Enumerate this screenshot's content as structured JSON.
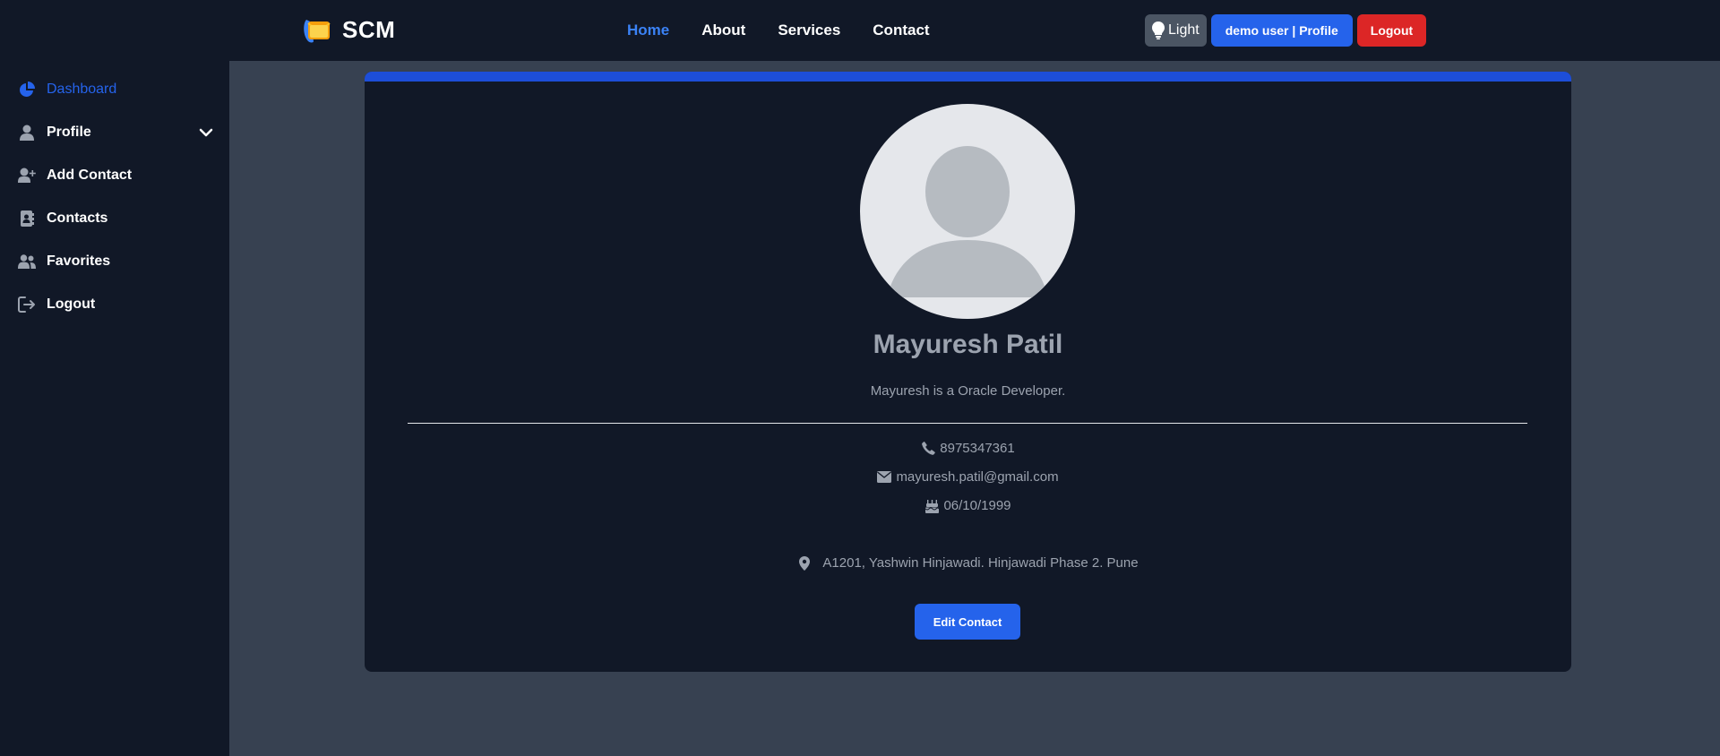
{
  "navbar": {
    "brand": "SCM",
    "links": [
      {
        "label": "Home",
        "active": true
      },
      {
        "label": "About",
        "active": false
      },
      {
        "label": "Services",
        "active": false
      },
      {
        "label": "Contact",
        "active": false
      }
    ],
    "theme_label": "Light",
    "profile_label": "demo user | Profile",
    "logout_label": "Logout"
  },
  "sidebar": {
    "items": [
      {
        "label": "Dashboard",
        "icon": "chart-pie-icon",
        "active": true
      },
      {
        "label": "Profile",
        "icon": "user-icon",
        "expandable": true
      },
      {
        "label": "Add Contact",
        "icon": "user-plus-icon"
      },
      {
        "label": "Contacts",
        "icon": "address-book-icon"
      },
      {
        "label": "Favorites",
        "icon": "users-icon"
      },
      {
        "label": "Logout",
        "icon": "sign-out-icon"
      }
    ]
  },
  "contact": {
    "name": "Mayuresh Patil",
    "description": "Mayuresh is a Oracle Developer.",
    "phone": "8975347361",
    "email": "mayuresh.patil@gmail.com",
    "dob": "06/10/1999",
    "address": "A1201, Yashwin Hinjawadi. Hinjawadi Phase 2. Pune",
    "edit_label": "Edit Contact"
  },
  "colors": {
    "accent": "#2563eb",
    "danger": "#dc2626",
    "background": "#111827",
    "main_bg": "#374151"
  }
}
